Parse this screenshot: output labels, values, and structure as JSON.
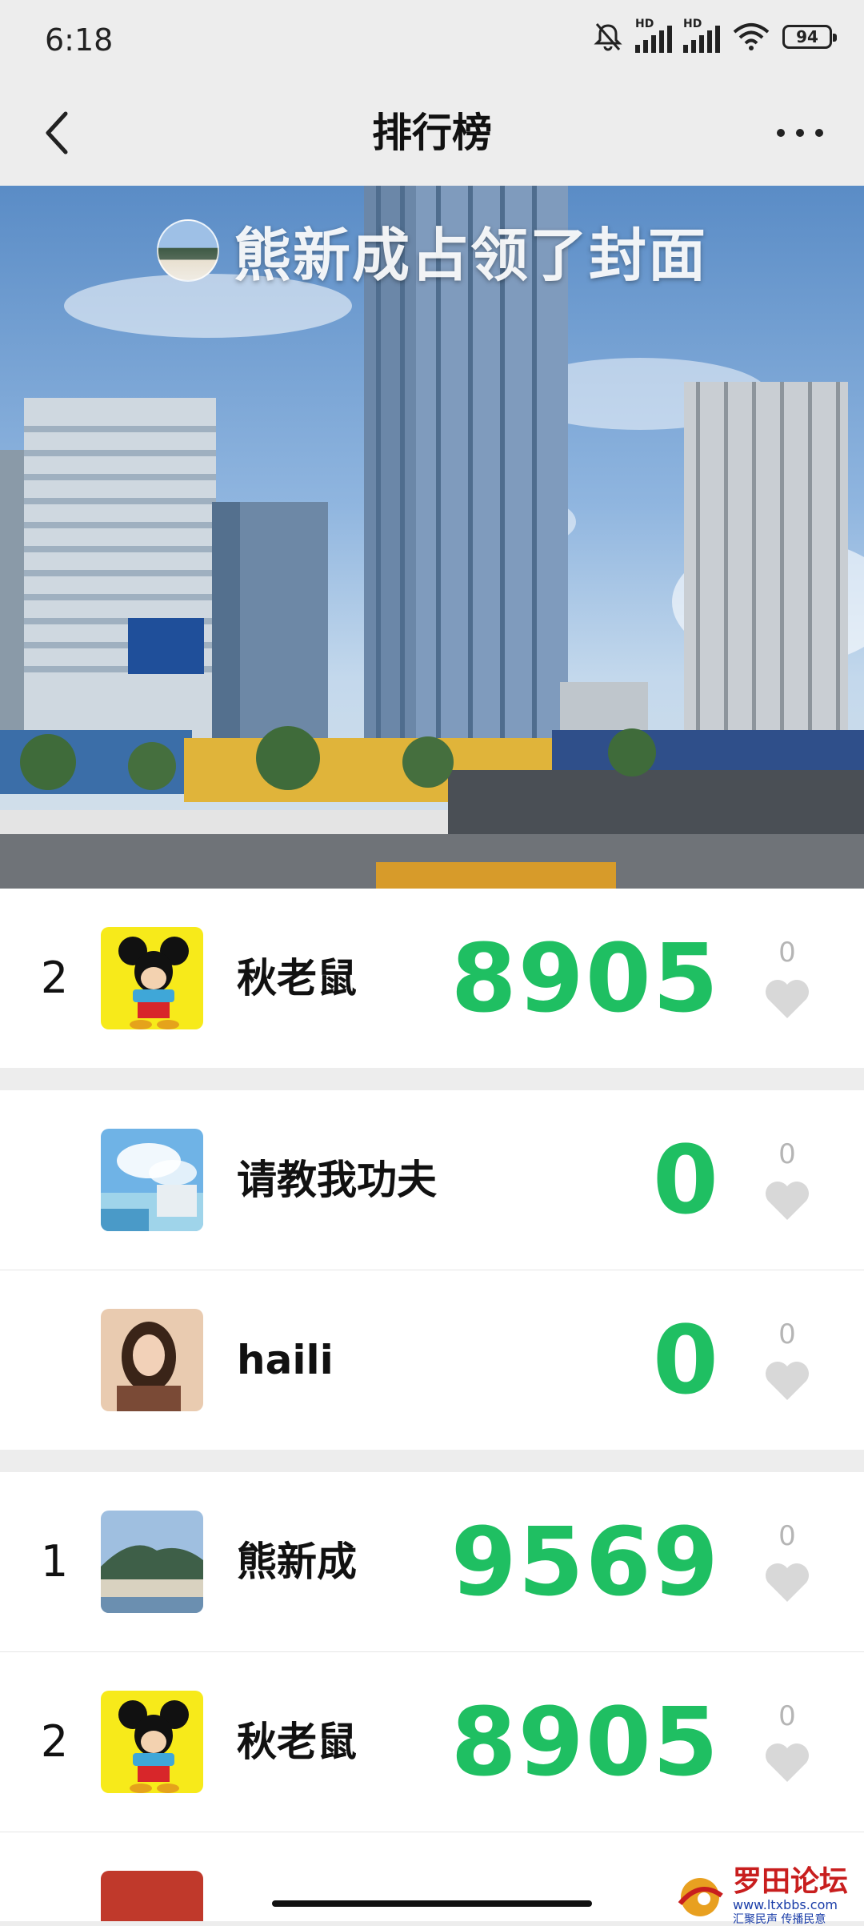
{
  "status_bar": {
    "time": "6:18",
    "hd_label": "HD",
    "battery": "94"
  },
  "nav": {
    "title": "排行榜"
  },
  "cover": {
    "caption": "熊新成占领了封面",
    "sky_color": "#5a8cc6"
  },
  "sections": [
    {
      "rows": [
        {
          "rank": "2",
          "name": "秋老鼠",
          "score": "8905",
          "likes": "0",
          "avatar": "mickey-avatar"
        }
      ]
    },
    {
      "rows": [
        {
          "rank": "",
          "name": "请教我功夫",
          "score": "0",
          "likes": "0",
          "avatar": "anime-sky-avatar"
        },
        {
          "rank": "",
          "name": "haili",
          "score": "0",
          "likes": "0",
          "avatar": "portrait-avatar"
        }
      ]
    },
    {
      "rows": [
        {
          "rank": "1",
          "name": "熊新成",
          "score": "9569",
          "likes": "0",
          "avatar": "landscape-avatar"
        },
        {
          "rank": "2",
          "name": "秋老鼠",
          "score": "8905",
          "likes": "0",
          "avatar": "mickey-avatar"
        }
      ]
    }
  ],
  "watermark": {
    "title": "罗田论坛",
    "url": "www.ltxbbs.com",
    "slogan": "汇聚民声  传播民意"
  },
  "colors": {
    "score_green": "#1fbf62",
    "background": "#ededed",
    "like_gray": "#b5b5b5"
  }
}
